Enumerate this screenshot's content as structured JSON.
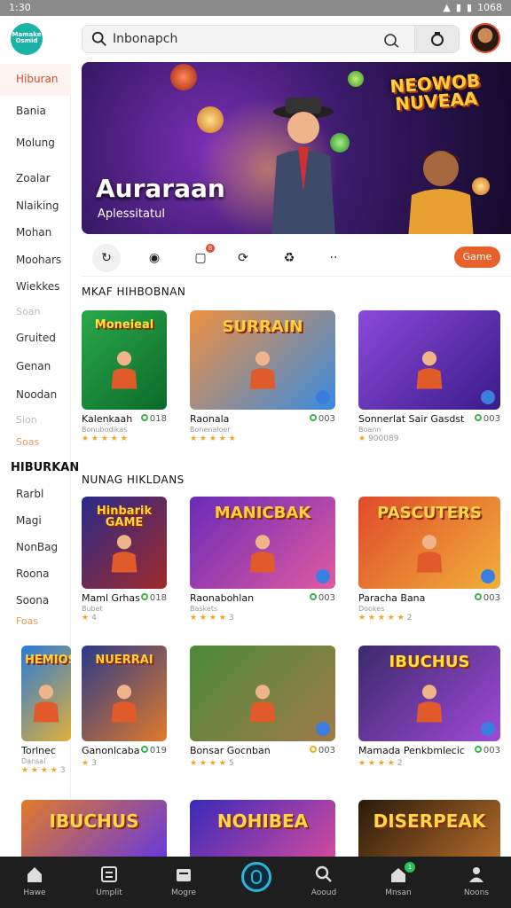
{
  "status": {
    "time": "1:30",
    "battery": "1068"
  },
  "header": {
    "logo_text": "Mamake Osmid",
    "search_value": "Inbonapch"
  },
  "sidebar": {
    "items": [
      {
        "label": "Hiburan",
        "type": "active"
      },
      {
        "label": "Bania",
        "type": "normal"
      },
      {
        "label": "Molung",
        "type": "normal"
      },
      {
        "label": "Zoalar",
        "type": "normal"
      },
      {
        "label": "Nlaiking",
        "type": "normal"
      },
      {
        "label": "Mohan",
        "type": "normal"
      },
      {
        "label": "Moohars",
        "type": "normal"
      },
      {
        "label": "Wiekkes",
        "type": "normal"
      },
      {
        "label": "Soan",
        "type": "muted"
      },
      {
        "label": "Gruited",
        "type": "normal"
      },
      {
        "label": "Genan",
        "type": "normal"
      },
      {
        "label": "Noodan",
        "type": "normal"
      },
      {
        "label": "Sion",
        "type": "muted"
      },
      {
        "label": "Soas",
        "type": "gold"
      },
      {
        "label": "HIBURKAN",
        "type": "header"
      },
      {
        "label": "Rarbl",
        "type": "normal"
      },
      {
        "label": "Magi",
        "type": "normal"
      },
      {
        "label": "NonBag",
        "type": "normal"
      },
      {
        "label": "Roona",
        "type": "normal"
      },
      {
        "label": "Soona",
        "type": "normal"
      },
      {
        "label": "Foas",
        "type": "gold"
      }
    ]
  },
  "banner": {
    "title": "Auraraan",
    "subtitle": "Aplessitatul",
    "logo_art": "NEOWOB NUVEAA"
  },
  "categories": {
    "icons": [
      "refresh-icon",
      "globe-icon",
      "square-icon",
      "loop-icon",
      "recycle-icon",
      "more-icon"
    ],
    "badge": "8",
    "button_label": "Game"
  },
  "sections": [
    {
      "title": "MKAF HIHBOBNAN",
      "cards": [
        {
          "name": "Kalenkaah",
          "score": "018",
          "meta": "Bonubodikas",
          "stars": "★ ★ ★ ★ ★",
          "votes": ""
        },
        {
          "name": "Raonala",
          "score": "003",
          "meta": "Bonenaloer",
          "stars": "★ ★ ★ ★ ★",
          "votes": ""
        },
        {
          "name": "Sonnerlat Sair Gasdst",
          "score": "003",
          "meta": "Boann",
          "stars": "★",
          "votes": "900089"
        }
      ]
    },
    {
      "title": "NUNAG HIKLDANS",
      "cards": [
        {
          "name": "Maml Grhas",
          "score": "018",
          "meta": "Bubet",
          "stars": "★",
          "votes": "4"
        },
        {
          "name": "Raonabohlan",
          "score": "003",
          "meta": "Baskets",
          "stars": "★ ★ ★ ★",
          "votes": "3"
        },
        {
          "name": "Paracha Bana",
          "score": "003",
          "meta": "Dookes",
          "stars": "★ ★ ★ ★ ★",
          "votes": "2"
        },
        {
          "name": "Torlnec",
          "score": "",
          "meta": "Dansal",
          "stars": "★ ★ ★ ★",
          "votes": "3"
        },
        {
          "name": "Ganonlcaba",
          "score": "019",
          "meta": "",
          "stars": "★",
          "votes": "3"
        },
        {
          "name": "Bonsar Gocnban",
          "score": "003",
          "meta": "",
          "stars": "★ ★ ★ ★",
          "votes": "5"
        },
        {
          "name": "Mamada Penkbmlecic",
          "score": "003",
          "meta": "",
          "stars": "★ ★ ★ ★",
          "votes": "2"
        }
      ]
    }
  ],
  "thumb_art": [
    "Moneieal",
    "SURRAIN",
    "",
    "Hinbarik GAME",
    "MANICBAK",
    "PASCUTERS",
    "HEMIOS",
    "NUERRAI",
    "",
    "IBUCHUS",
    "NOHIBEA",
    "DISERPEAK"
  ],
  "bottom_nav": [
    {
      "label": "Hawe",
      "icon": "home-icon"
    },
    {
      "label": "Umplit",
      "icon": "list-icon"
    },
    {
      "label": "Mogre",
      "icon": "stack-icon"
    },
    {
      "label": "",
      "icon": "play-center-icon"
    },
    {
      "label": "Aooud",
      "icon": "search-icon"
    },
    {
      "label": "Mnsan",
      "icon": "gift-icon",
      "badge": "1"
    },
    {
      "label": "Noons",
      "icon": "profile-icon"
    }
  ],
  "colors": {
    "accent": "#e7622b",
    "active": "#d84a2a",
    "nav_bg": "#1e1e1e"
  }
}
